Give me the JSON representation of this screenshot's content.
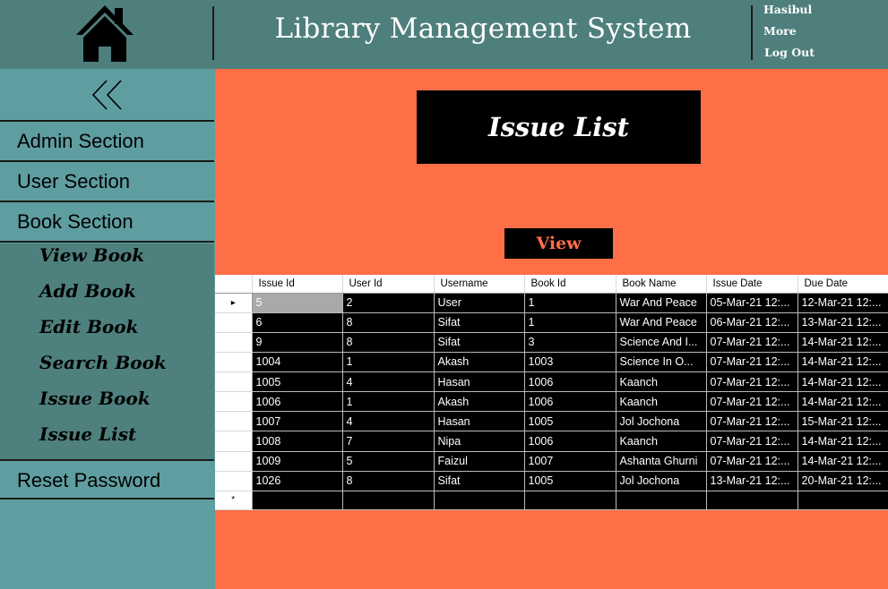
{
  "header": {
    "title": "Library Management System",
    "user_name": "Hasibul",
    "more_label": "More",
    "logout_label": "Log Out"
  },
  "sidebar": {
    "sections": [
      "Admin Section",
      "User Section",
      "Book Section"
    ],
    "book_sub_items": [
      "View Book",
      "Add Book",
      "Edit Book",
      "Search Book",
      "Issue Book",
      "Issue List"
    ],
    "reset_password": "Reset Password"
  },
  "main": {
    "title": "Issue List",
    "view_button": "View"
  },
  "grid": {
    "columns": [
      "Issue Id",
      "User Id",
      "Username",
      "Book Id",
      "Book Name",
      "Issue Date",
      "Due Date"
    ],
    "rows": [
      [
        "5",
        "2",
        "User",
        "1",
        "War And Peace",
        "05-Mar-21 12:...",
        "12-Mar-21 12:..."
      ],
      [
        "6",
        "8",
        "Sifat",
        "1",
        "War And Peace",
        "06-Mar-21 12:...",
        "13-Mar-21 12:..."
      ],
      [
        "9",
        "8",
        "Sifat",
        "3",
        "Science And I...",
        "07-Mar-21 12:...",
        "14-Mar-21 12:..."
      ],
      [
        "1004",
        "1",
        "Akash",
        "1003",
        "Science In O...",
        "07-Mar-21 12:...",
        "14-Mar-21 12:..."
      ],
      [
        "1005",
        "4",
        "Hasan",
        "1006",
        "Kaanch",
        "07-Mar-21 12:...",
        "14-Mar-21 12:..."
      ],
      [
        "1006",
        "1",
        "Akash",
        "1006",
        "Kaanch",
        "07-Mar-21 12:...",
        "14-Mar-21 12:..."
      ],
      [
        "1007",
        "4",
        "Hasan",
        "1005",
        "Jol Jochona",
        "07-Mar-21 12:...",
        "15-Mar-21 12:..."
      ],
      [
        "1008",
        "7",
        "Nipa",
        "1006",
        "Kaanch",
        "07-Mar-21 12:...",
        "14-Mar-21 12:..."
      ],
      [
        "1009",
        "5",
        "Faizul",
        "1007",
        "Ashanta Ghurni",
        "07-Mar-21 12:...",
        "14-Mar-21 12:..."
      ],
      [
        "1026",
        "8",
        "Sifat",
        "1005",
        "Jol Jochona",
        "13-Mar-21 12:...",
        "20-Mar-21 12:..."
      ]
    ],
    "current_row_marker": "▸",
    "new_row_marker": "*"
  },
  "colors": {
    "header_bg": "#4e7f7d",
    "sidebar_bg": "#5f9ea0",
    "submenu_bg": "#4e807e",
    "main_bg": "#ff6f47",
    "grid_bg": "#000000",
    "selected_cell": "#a9a9a9"
  },
  "icons": {
    "home": "home-icon",
    "collapse": "double-chevron-left-icon",
    "row_pointer": "row-pointer-icon"
  }
}
